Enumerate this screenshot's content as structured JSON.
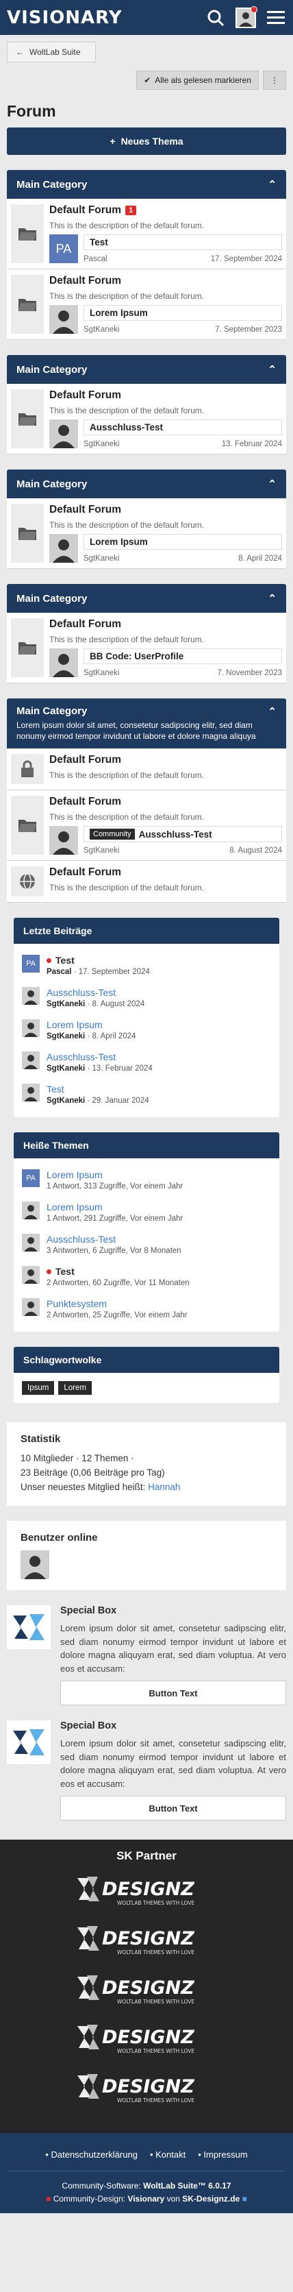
{
  "brand": "VISIONARY",
  "breadcrumb": "WoltLab Suite",
  "mark_all_read": "Alle als gelesen markieren",
  "page_title": "Forum",
  "new_thread": "Neues Thema",
  "categories": [
    {
      "title": "Main Category",
      "description": "",
      "forums": [
        {
          "title": "Default Forum",
          "badge": "1",
          "desc": "This is the description of the default forum.",
          "last_thread": "Test",
          "last_user": "Pascal",
          "last_date": "17. September 2024",
          "avatar": "PA"
        },
        {
          "title": "Default Forum",
          "desc": "This is the description of the default forum.",
          "last_thread": "Lorem Ipsum",
          "last_user": "SgtKaneki",
          "last_date": "7. September 2023"
        }
      ]
    },
    {
      "title": "Main Category",
      "forums": [
        {
          "title": "Default Forum",
          "desc": "This is the description of the default forum.",
          "last_thread": "Ausschluss-Test",
          "last_user": "SgtKaneki",
          "last_date": "13. Februar 2024"
        }
      ]
    },
    {
      "title": "Main Category",
      "forums": [
        {
          "title": "Default Forum",
          "desc": "This is the description of the default forum.",
          "last_thread": "Lorem Ipsum",
          "last_user": "SgtKaneki",
          "last_date": "8. April 2024"
        }
      ]
    },
    {
      "title": "Main Category",
      "forums": [
        {
          "title": "Default Forum",
          "desc": "This is the description of the default forum.",
          "last_thread": "BB Code: UserProfile",
          "last_user": "SgtKaneki",
          "last_date": "7. November 2023"
        }
      ]
    },
    {
      "title": "Main Category",
      "description": "Lorem ipsum dolor sit amet, consetetur sadipscing elitr, sed diam nonumy eirmod tempor invidunt ut labore et dolore magna aliquya",
      "forums": [
        {
          "title": "Default Forum",
          "desc": "This is the description of the default forum."
        },
        {
          "title": "Default Forum",
          "desc": "This is the description of the default forum.",
          "last_thread": "Ausschluss-Test",
          "last_prefix": "Community",
          "last_user": "SgtKaneki",
          "last_date": "8. August 2024"
        },
        {
          "title": "Default Forum",
          "desc": "This is the description of the default forum."
        }
      ]
    }
  ],
  "latest": {
    "title": "Letzte Beiträge",
    "items": [
      {
        "title": "Test",
        "user": "Pascal",
        "date": "17. September 2024",
        "unread": true,
        "avatar": "PA"
      },
      {
        "title": "Ausschluss-Test",
        "user": "SgtKaneki",
        "date": "8. August 2024"
      },
      {
        "title": "Lorem Ipsum",
        "user": "SgtKaneki",
        "date": "8. April 2024"
      },
      {
        "title": "Ausschluss-Test",
        "user": "SgtKaneki",
        "date": "13. Februar 2024"
      },
      {
        "title": "Test",
        "user": "SgtKaneki",
        "date": "29. Januar 2024"
      }
    ]
  },
  "hot": {
    "title": "Heiße Themen",
    "items": [
      {
        "title": "Lorem Ipsum",
        "meta": "1 Antwort, 313 Zugriffe, Vor einem Jahr",
        "avatar": "PA"
      },
      {
        "title": "Lorem Ipsum",
        "meta": "1 Antwort, 291 Zugriffe, Vor einem Jahr"
      },
      {
        "title": "Ausschluss-Test",
        "meta": "3 Antworten, 6 Zugriffe, Vor 8 Monaten"
      },
      {
        "title": "Test",
        "meta": "2 Antworten, 60 Zugriffe, Vor 11 Monaten",
        "unread": true
      },
      {
        "title": "Punktesystem",
        "meta": "2 Antworten, 25 Zugriffe, Vor einem Jahr"
      }
    ]
  },
  "tagcloud": {
    "title": "Schlagwortwolke",
    "tags": [
      "Ipsum",
      "Lorem"
    ]
  },
  "stats": {
    "title": "Statistik",
    "line1": "10 Mitglieder · 12 Themen ·",
    "line2": "23 Beiträge (0,06 Beiträge pro Tag)",
    "line3": "Unser neuestes Mitglied heißt: ",
    "newest": "Hannah"
  },
  "online": {
    "title": "Benutzer online"
  },
  "special": [
    {
      "title": "Special Box",
      "text": "Lorem ipsum dolor sit amet, consetetur sadipscing elitr, sed diam nonumy eirmod tempor invidunt ut labore et dolore magna aliquyam erat, sed diam voluptua. At vero eos et accusam:",
      "button": "Button Text"
    },
    {
      "title": "Special Box",
      "text": "Lorem ipsum dolor sit amet, consetetur sadipscing elitr, sed diam nonumy eirmod tempor invidunt ut labore et dolore magna aliquyam erat, sed diam voluptua. At vero eos et accusam:",
      "button": "Button Text"
    }
  ],
  "partner": {
    "title": "SK Partner",
    "logo_text": "SK DESIGNZ",
    "logo_sub": "WOLTLAB THEMES WITH LOVE",
    "count": 5
  },
  "footer": {
    "links": [
      "Datenschutzerklärung",
      "Kontakt",
      "Impressum"
    ],
    "line1a": "Community-Software: ",
    "line1b": "WoltLab Suite™ 6.0.17",
    "line2a": "Community-Design: ",
    "line2b": "Visionary",
    "line2c": " von ",
    "line2d": "SK-Designz.de"
  },
  "colors": {
    "primary": "#1f3a5f",
    "accent": "#e02b2b",
    "link": "#3a7ad0"
  }
}
